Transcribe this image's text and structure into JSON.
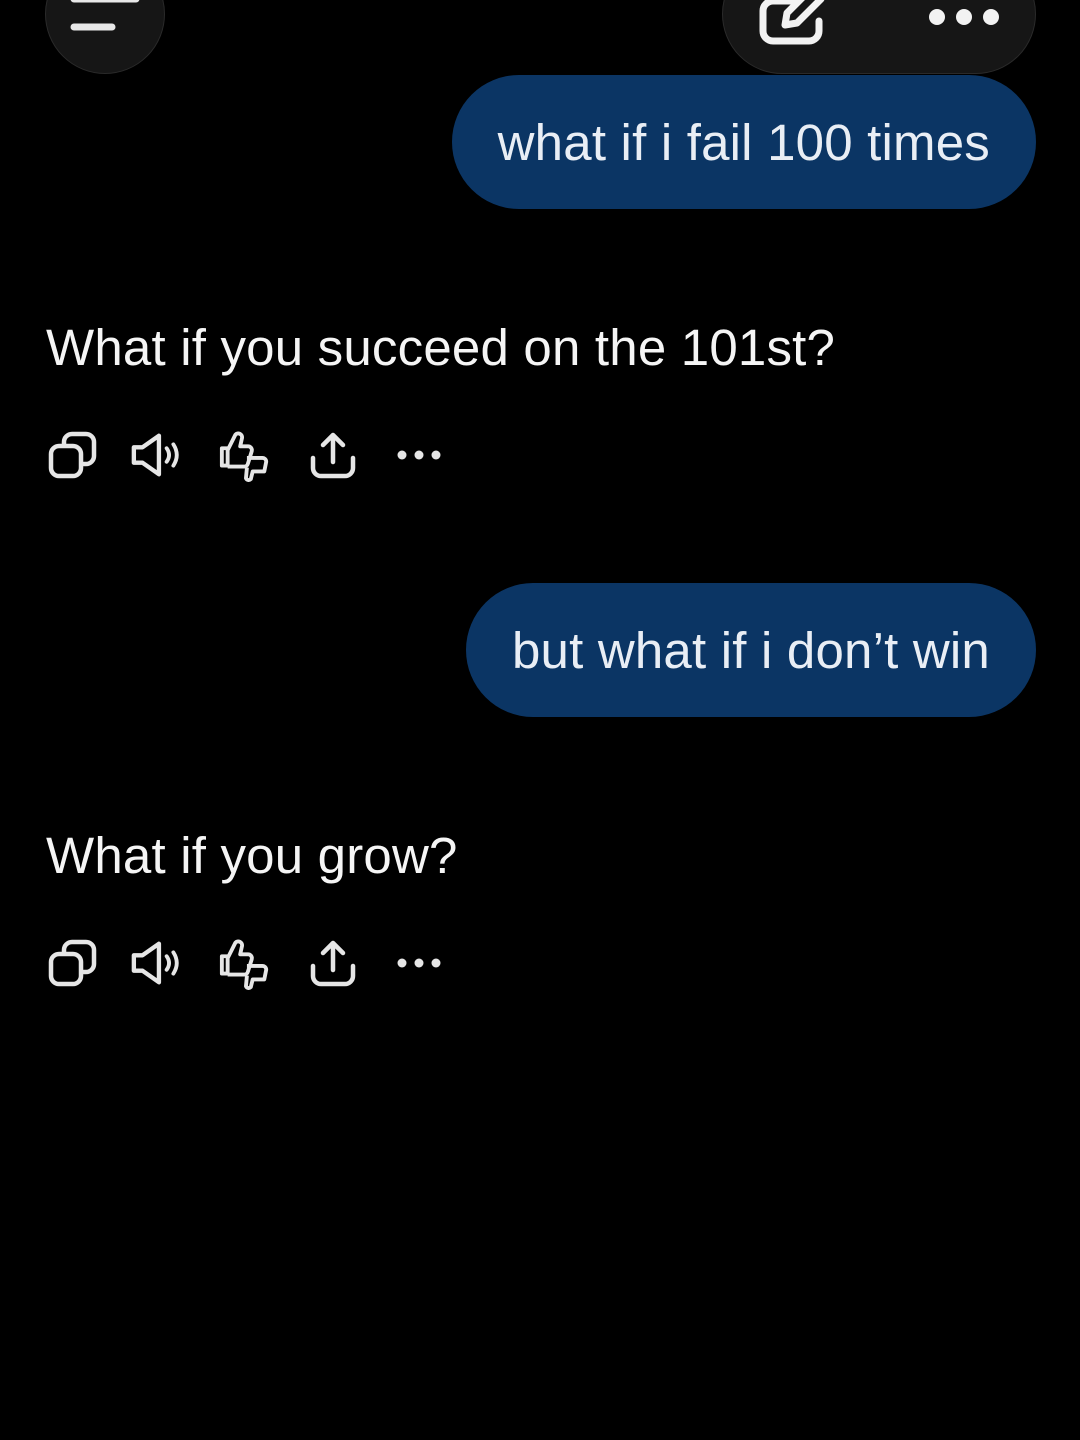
{
  "header": {
    "menu_icon": "menu-icon",
    "edit_icon": "new-chat-edit-icon",
    "more_icon": "more-options-icon"
  },
  "conversation": [
    {
      "role": "user",
      "text": "what if i fail 100 times"
    },
    {
      "role": "assistant",
      "text": "What if you succeed on the 101st?",
      "actions": [
        "copy-icon",
        "read-aloud-icon",
        "feedback-icon",
        "share-icon",
        "more-icon"
      ]
    },
    {
      "role": "user",
      "text": "but what if i don’t win"
    },
    {
      "role": "assistant",
      "text": "What if you grow?",
      "actions": [
        "copy-icon",
        "read-aloud-icon",
        "feedback-icon",
        "share-icon",
        "more-icon"
      ]
    }
  ],
  "colors": {
    "background": "#000000",
    "user_bubble": "#0b3564",
    "text": "#f5f5f5",
    "control_bg": "#161616"
  }
}
